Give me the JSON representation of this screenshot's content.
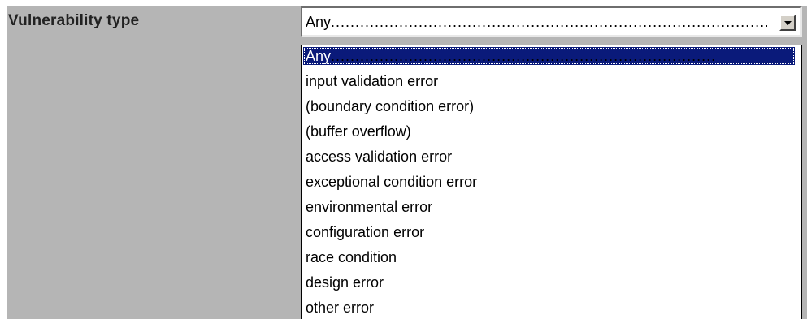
{
  "field": {
    "label": "Vulnerability type"
  },
  "select": {
    "value": "Any",
    "value_dots": "..........................................................................................................."
  },
  "options": [
    {
      "label": "Any",
      "dots": "...............................................................................",
      "selected": true
    },
    {
      "label": "input validation error"
    },
    {
      "label": "(boundary condition error)"
    },
    {
      "label": "(buffer overflow)"
    },
    {
      "label": "access validation error"
    },
    {
      "label": "exceptional condition error"
    },
    {
      "label": "environmental error"
    },
    {
      "label": "configuration error"
    },
    {
      "label": "race condition"
    },
    {
      "label": "design error"
    },
    {
      "label": "other error"
    }
  ],
  "colors": {
    "highlight": "#0a1a7a",
    "panel_gray": "#b5b5b5"
  },
  "icons": {
    "dropdown": "chevron-down-icon"
  }
}
